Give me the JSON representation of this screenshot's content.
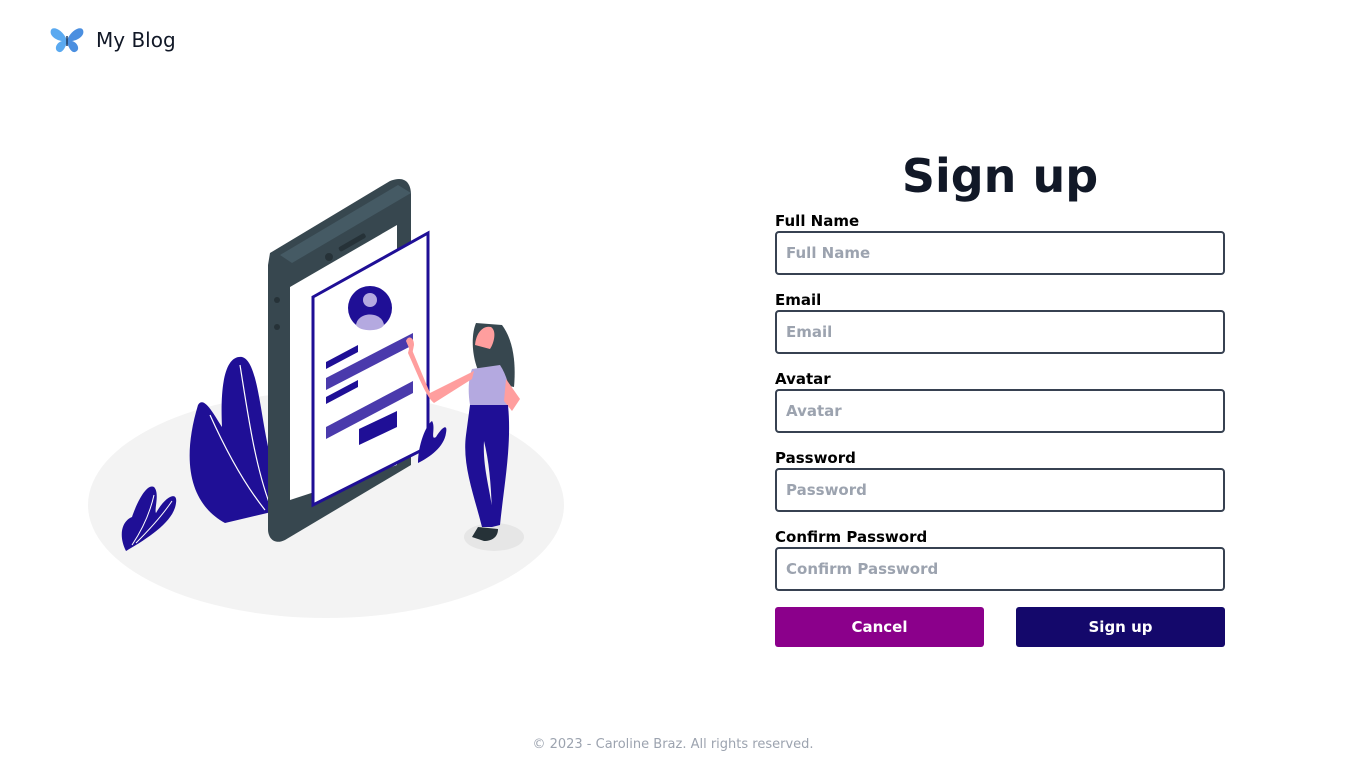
{
  "header": {
    "logo_icon": "butterfly-icon",
    "brand": "My Blog"
  },
  "illustration": {
    "description_icon": "phone-signup-illustration"
  },
  "form": {
    "title": "Sign up",
    "fields": [
      {
        "label": "Full Name",
        "placeholder": "Full Name",
        "value": ""
      },
      {
        "label": "Email",
        "placeholder": "Email",
        "value": ""
      },
      {
        "label": "Avatar",
        "placeholder": "Avatar",
        "value": ""
      },
      {
        "label": "Password",
        "placeholder": "Password",
        "value": ""
      },
      {
        "label": "Confirm Password",
        "placeholder": "Confirm Password",
        "value": ""
      }
    ],
    "cancel_label": "Cancel",
    "submit_label": "Sign up"
  },
  "colors": {
    "accent_cancel": "#8b008b",
    "accent_primary": "#14086b",
    "illustration_purple": "#1f0f96"
  },
  "footer": {
    "copyright": "© 2023 - Caroline Braz. All rights reserved."
  }
}
